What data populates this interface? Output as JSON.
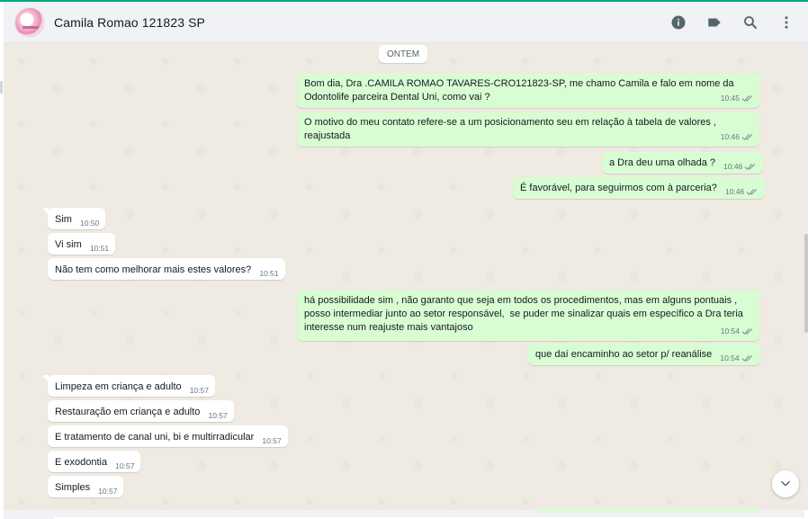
{
  "header": {
    "contact_name": "Camila Romao 121823 SP",
    "icons": [
      "info-icon",
      "label-icon",
      "search-icon",
      "menu-icon"
    ]
  },
  "chat": {
    "date_chip": "ONTEM",
    "messages": [
      {
        "dir": "out",
        "text": "Bom dia, Dra .CAMILA ROMAO TAVARES-CRO121823-SP, me chamo Camila e falo em nome da\nOdontolife parceira Dental Uni, como vai ?",
        "time": "10:45",
        "ticks": true
      },
      {
        "dir": "out",
        "text": "O motivo do meu contato refere-se a um posicionamento seu em relação à tabela de valores ,\nreajustada",
        "time": "10:46",
        "ticks": true
      },
      {
        "dir": "out",
        "text": "a Dra deu uma olhada ?",
        "time": "10:46",
        "ticks": true
      },
      {
        "dir": "out",
        "text": "É favorável, para seguirmos com à parceria?",
        "time": "10:46",
        "ticks": true
      },
      {
        "dir": "in",
        "text": "Sim",
        "time": "10:50"
      },
      {
        "dir": "in",
        "text": "Vi sim",
        "time": "10:51"
      },
      {
        "dir": "in",
        "text": "Não tem como melhorar mais estes valores?",
        "time": "10:51"
      },
      {
        "dir": "out",
        "text": "há possibilidade sim , não garanto que seja em todos os procedimentos, mas em alguns pontuais ,\nposso intermediar junto ao setor responsável,  se puder me sinalizar quais em específico a Dra teria\ninteresse num reajuste mais vantajoso",
        "time": "10:54",
        "ticks": true
      },
      {
        "dir": "out",
        "text": "que daí encaminho ao setor p/ reanálise",
        "time": "10:54",
        "ticks": true
      },
      {
        "dir": "in",
        "text": "Limpeza em criança e adulto",
        "time": "10:57"
      },
      {
        "dir": "in",
        "text": "Restauração em criança e adulto",
        "time": "10:57"
      },
      {
        "dir": "in",
        "text": "E tratamento de canal uni, bi e multirradicular",
        "time": "10:57"
      },
      {
        "dir": "in",
        "text": "E exodontia",
        "time": "10:57"
      },
      {
        "dir": "in",
        "text": "Simples",
        "time": "10:57"
      }
    ]
  },
  "colors": {
    "outgoing_bubble": "#d9fdd3",
    "incoming_bubble": "#ffffff",
    "chat_background": "#efeae2",
    "header_background": "#f0f2f5",
    "read_ticks": "#8696a0"
  },
  "scroll_down_icon": "chevron-down-icon"
}
